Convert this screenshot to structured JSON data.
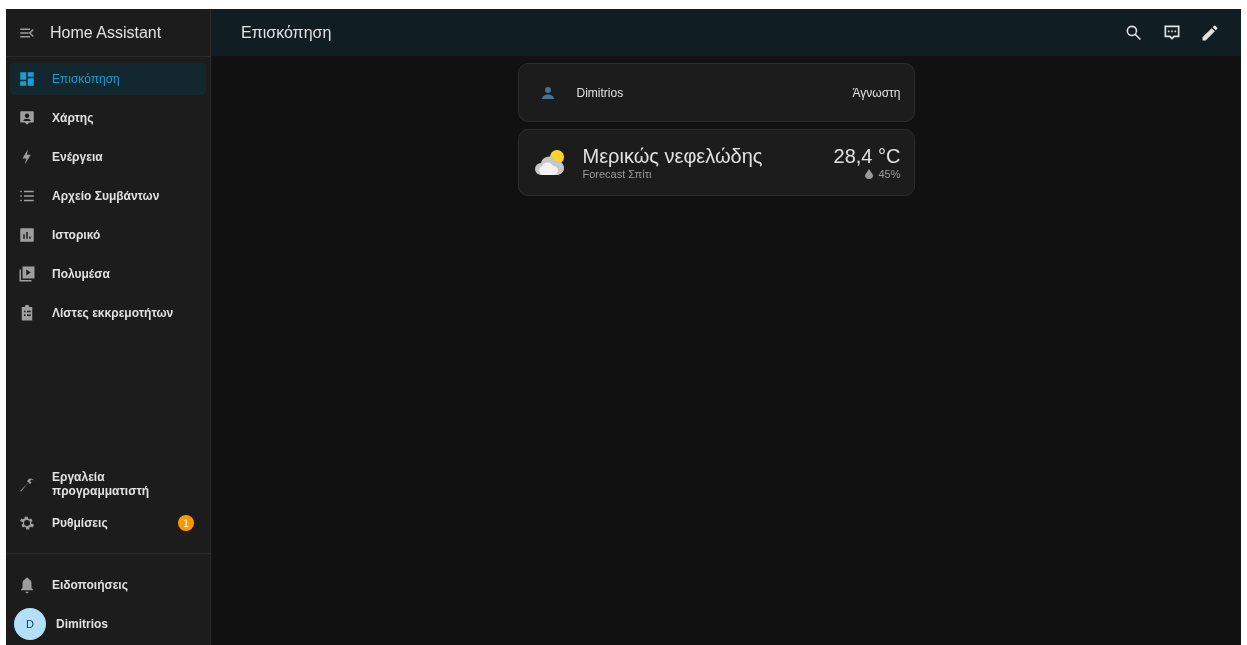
{
  "sidebar": {
    "title": "Home Assistant",
    "items": [
      {
        "kind": "dashboard",
        "label": "Επισκόπηση",
        "selected": true
      },
      {
        "kind": "map",
        "label": "Χάρτης",
        "selected": false
      },
      {
        "kind": "energy",
        "label": "Ενέργεια",
        "selected": false
      },
      {
        "kind": "logbook",
        "label": "Αρχείο Συμβάντων",
        "selected": false
      },
      {
        "kind": "history",
        "label": "Ιστορικό",
        "selected": false
      },
      {
        "kind": "media",
        "label": "Πολυμέσα",
        "selected": false
      },
      {
        "kind": "todo",
        "label": "Λίστες εκκρεμοτήτων",
        "selected": false
      }
    ],
    "bottom_items": [
      {
        "kind": "tools",
        "label": "Εργαλεία προγραμματιστή",
        "selected": false
      },
      {
        "kind": "settings",
        "label": "Ρυθμίσεις",
        "selected": false,
        "badge": "1"
      }
    ],
    "notifications": {
      "label": "Ειδοποιήσεις"
    },
    "user": {
      "initial": "D",
      "name": "Dimitrios"
    }
  },
  "header": {
    "title": "Επισκόπηση"
  },
  "cards": [
    {
      "kind": "entity",
      "name": "Dimitrios",
      "state": "Άγνωστη"
    },
    {
      "kind": "weather",
      "condition": "Μερικώς νεφελώδης",
      "source": "Forecast Σπίτι",
      "temperature": "28,4 °C",
      "humidity": "45%"
    }
  ]
}
